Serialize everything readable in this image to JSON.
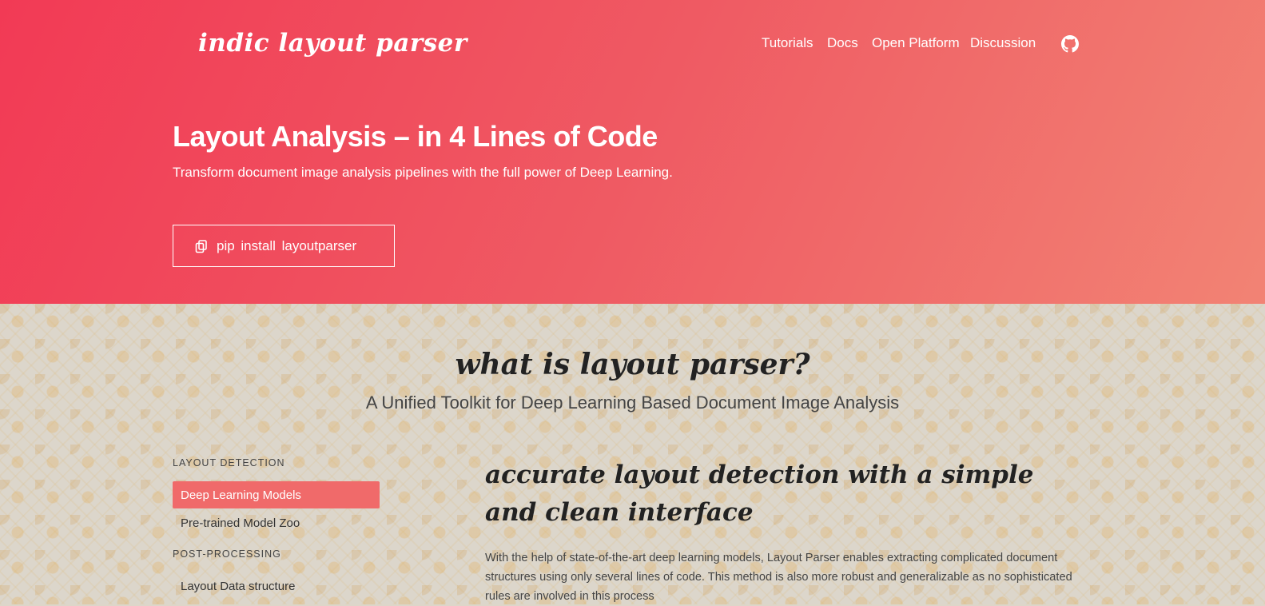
{
  "header": {
    "logo_text": "indic layout parser",
    "nav": [
      "Tutorials",
      "Docs",
      "Open Platform",
      "Discussion"
    ],
    "github_icon": "github-icon"
  },
  "hero": {
    "title": "Layout Analysis – in 4 Lines of Code",
    "subtitle": "Transform document image analysis pipelines with the full power of Deep Learning.",
    "install_label": "pip install layoutparser",
    "install_icon": "copy-icon"
  },
  "section": {
    "title": "what is layout parser?",
    "subtitle": "A Unified Toolkit for Deep Learning Based Document Image Analysis"
  },
  "sidebar": {
    "group1_heading": "LAYOUT DETECTION",
    "group1_items": [
      "Deep Learning Models",
      "Pre-trained Model Zoo"
    ],
    "group2_heading": "POST-PROCESSING",
    "group2_items": [
      "Layout Data structure"
    ]
  },
  "feature": {
    "title": "accurate layout detection with a simple and clean interface",
    "text": "With the help of state-of-the-art deep learning models, Layout Parser enables extracting complicated document structures using only several lines of code. This method is also more robust and generalizable as no sophisticated rules are involved in this process"
  },
  "colors": {
    "hero_gradient_start": "#f23a55",
    "hero_gradient_end": "#f28374",
    "active_item": "#f06a6a"
  }
}
